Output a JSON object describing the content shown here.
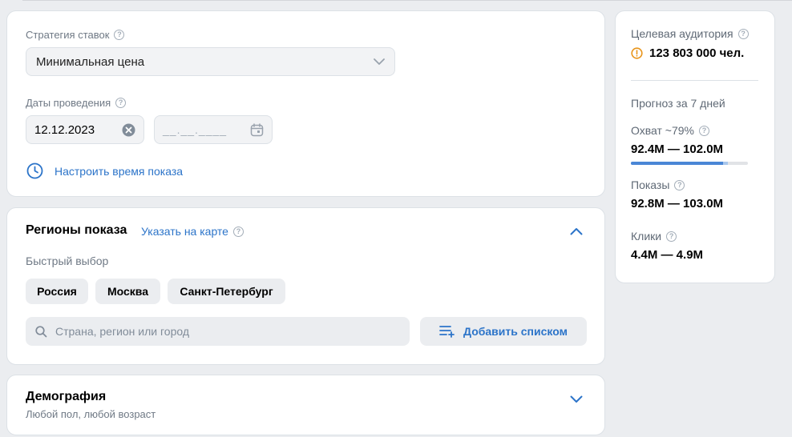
{
  "bidding": {
    "strategy_label": "Стратегия ставок",
    "strategy_value": "Минимальная цена",
    "dates_label": "Даты проведения",
    "date_start": "12.12.2023",
    "date_end_placeholder": "__.__.____",
    "time_link": "Настроить время показа"
  },
  "regions": {
    "title": "Регионы показа",
    "map_link": "Указать на карте",
    "quick_label": "Быстрый выбор",
    "chips": [
      "Россия",
      "Москва",
      "Санкт-Петербург"
    ],
    "search_placeholder": "Страна, регион или город",
    "add_list": "Добавить списком"
  },
  "demography": {
    "title": "Демография",
    "subtitle": "Любой пол, любой возраст"
  },
  "audience": {
    "label": "Целевая аудитория",
    "value": "123 803 000 чел.",
    "forecast_title": "Прогноз за 7 дней",
    "reach_label": "Охват ~79%",
    "reach_value": "92.4M — 102.0M",
    "reach_fraction": 0.79,
    "reach_upper_fraction": 0.83,
    "impressions_label": "Показы",
    "impressions_value": "92.8M — 103.0M",
    "clicks_label": "Клики",
    "clicks_value": "4.4M — 4.9M"
  },
  "colors": {
    "accent": "#2c74c9",
    "warning": "#e8941a",
    "background": "#ebedf0"
  }
}
